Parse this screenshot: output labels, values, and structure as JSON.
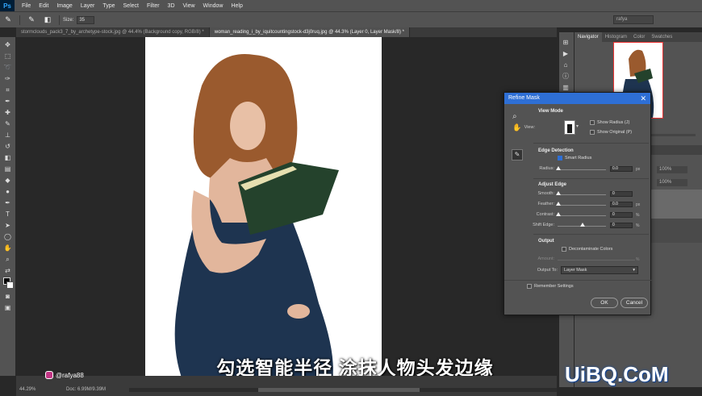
{
  "app": {
    "logo": "Ps"
  },
  "menu": [
    "File",
    "Edit",
    "Image",
    "Layer",
    "Type",
    "Select",
    "Filter",
    "3D",
    "View",
    "Window",
    "Help"
  ],
  "options": {
    "size_label": "Size:",
    "size_value": "35",
    "search_text": "rafya"
  },
  "tabs": [
    {
      "label": "stormclouds_pack3_7_by_archetype-stock.jpg @ 44.4% (Background copy, RGB/8) *",
      "active": false
    },
    {
      "label": "woman_reading_i_by_iquitcountingstock-d3j0ruq.jpg @ 44.3% (Layer 0, Layer Mask/8) *",
      "active": true
    }
  ],
  "panel_tabs": [
    "Navigator",
    "Histogram",
    "Color",
    "Swatches"
  ],
  "panel_values": {
    "opacity": "100%",
    "fill": "100%"
  },
  "status": {
    "zoom": "44.29%",
    "doc": "Doc: 6.99M/9.39M"
  },
  "dialog": {
    "title": "Refine Mask",
    "view_mode": {
      "heading": "View Mode",
      "view_label": "View:",
      "show_radius": "Show Radius (J)",
      "show_original": "Show Original (P)"
    },
    "edge_detection": {
      "heading": "Edge Detection",
      "smart_radius": "Smart Radius",
      "smart_radius_checked": true,
      "radius_label": "Radius:",
      "radius_value": "0.0",
      "radius_unit": "px"
    },
    "adjust_edge": {
      "heading": "Adjust Edge",
      "rows": [
        {
          "label": "Smooth:",
          "value": "0",
          "unit": ""
        },
        {
          "label": "Feather:",
          "value": "0.0",
          "unit": "px"
        },
        {
          "label": "Contrast:",
          "value": "0",
          "unit": "%"
        },
        {
          "label": "Shift Edge:",
          "value": "0",
          "unit": "%"
        }
      ]
    },
    "output": {
      "heading": "Output",
      "decontaminate": "Decontaminate Colors",
      "amount_label": "Amount:",
      "amount_unit": "%",
      "output_to_label": "Output To:",
      "output_to_value": "Layer Mask"
    },
    "remember": "Remember Settings",
    "ok": "OK",
    "cancel": "Cancel"
  },
  "overlay": {
    "subtitle": "勾选智能半径 涂抹人物头发边缘",
    "handle": "@rafya88",
    "watermark": "UiBQ.CoM"
  },
  "icons": [
    "brush-icon",
    "eraser-icon",
    "move-icon",
    "marquee-icon",
    "lasso-icon",
    "quick-select-icon",
    "crop-icon",
    "eyedropper-icon",
    "healing-icon",
    "brush-tool-icon",
    "stamp-icon",
    "history-brush-icon",
    "eraser-tool-icon",
    "gradient-icon",
    "blur-icon",
    "dodge-icon",
    "pen-icon",
    "type-icon",
    "path-select-icon",
    "shape-icon",
    "hand-icon",
    "zoom-icon",
    "zoom-tool-icon",
    "hand-tool-icon",
    "close-icon",
    "chevron-down-icon"
  ]
}
